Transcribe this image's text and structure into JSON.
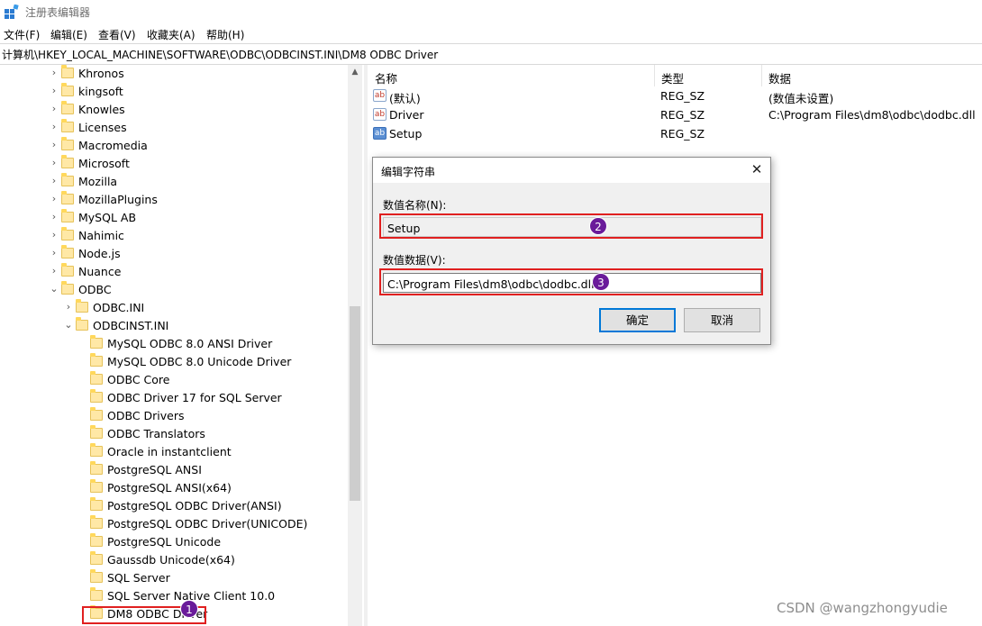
{
  "window": {
    "title": "注册表编辑器"
  },
  "menu": [
    "文件(F)",
    "编辑(E)",
    "查看(V)",
    "收藏夹(A)",
    "帮助(H)"
  ],
  "address": "计算机\\HKEY_LOCAL_MACHINE\\SOFTWARE\\ODBC\\ODBCINST.INI\\DM8 ODBC Driver",
  "tree": {
    "items": [
      {
        "label": "Khronos",
        "level": 0,
        "expander": "collapsed"
      },
      {
        "label": "kingsoft",
        "level": 0,
        "expander": "collapsed"
      },
      {
        "label": "Knowles",
        "level": 0,
        "expander": "collapsed"
      },
      {
        "label": "Licenses",
        "level": 0,
        "expander": "collapsed"
      },
      {
        "label": "Macromedia",
        "level": 0,
        "expander": "collapsed"
      },
      {
        "label": "Microsoft",
        "level": 0,
        "expander": "collapsed"
      },
      {
        "label": "Mozilla",
        "level": 0,
        "expander": "collapsed"
      },
      {
        "label": "MozillaPlugins",
        "level": 0,
        "expander": "collapsed"
      },
      {
        "label": "MySQL AB",
        "level": 0,
        "expander": "collapsed"
      },
      {
        "label": "Nahimic",
        "level": 0,
        "expander": "collapsed"
      },
      {
        "label": "Node.js",
        "level": 0,
        "expander": "collapsed"
      },
      {
        "label": "Nuance",
        "level": 0,
        "expander": "collapsed"
      },
      {
        "label": "ODBC",
        "level": 0,
        "expander": "expanded"
      },
      {
        "label": "ODBC.INI",
        "level": 1,
        "expander": "collapsed"
      },
      {
        "label": "ODBCINST.INI",
        "level": 1,
        "expander": "expanded"
      },
      {
        "label": "MySQL ODBC 8.0 ANSI Driver",
        "level": 2,
        "expander": "none"
      },
      {
        "label": "MySQL ODBC 8.0 Unicode Driver",
        "level": 2,
        "expander": "none"
      },
      {
        "label": "ODBC Core",
        "level": 2,
        "expander": "none"
      },
      {
        "label": "ODBC Driver 17 for SQL Server",
        "level": 2,
        "expander": "none"
      },
      {
        "label": "ODBC Drivers",
        "level": 2,
        "expander": "none"
      },
      {
        "label": "ODBC Translators",
        "level": 2,
        "expander": "none"
      },
      {
        "label": "Oracle in instantclient",
        "level": 2,
        "expander": "none"
      },
      {
        "label": "PostgreSQL ANSI",
        "level": 2,
        "expander": "none"
      },
      {
        "label": "PostgreSQL ANSI(x64)",
        "level": 2,
        "expander": "none"
      },
      {
        "label": "PostgreSQL ODBC Driver(ANSI)",
        "level": 2,
        "expander": "none"
      },
      {
        "label": "PostgreSQL ODBC Driver(UNICODE)",
        "level": 2,
        "expander": "none"
      },
      {
        "label": "PostgreSQL Unicode",
        "level": 2,
        "expander": "none"
      },
      {
        "label": "Gaussdb Unicode(x64)",
        "level": 2,
        "expander": "none"
      },
      {
        "label": "SQL Server",
        "level": 2,
        "expander": "none"
      },
      {
        "label": "SQL Server Native Client 10.0",
        "level": 2,
        "expander": "none"
      },
      {
        "label": "DM8 ODBC Driver",
        "level": 2,
        "expander": "none",
        "selected": true
      }
    ]
  },
  "list": {
    "columns": [
      "名称",
      "类型",
      "数据"
    ],
    "rows": [
      {
        "icon": "string-value-icon",
        "name": "(默认)",
        "type": "REG_SZ",
        "data": "(数值未设置)"
      },
      {
        "icon": "string-value-icon",
        "name": "Driver",
        "type": "REG_SZ",
        "data": "C:\\Program Files\\dm8\\odbc\\dodbc.dll"
      },
      {
        "icon": "string-value-icon",
        "name": "Setup",
        "type": "REG_SZ",
        "data": "",
        "selected": true
      }
    ]
  },
  "dialog": {
    "title": "编辑字符串",
    "close_glyph": "✕",
    "name_label": "数值名称(N):",
    "name_value": "Setup",
    "data_label": "数值数据(V):",
    "data_value": "C:\\Program Files\\dm8\\odbc\\dodbc.dll",
    "ok_label": "确定",
    "cancel_label": "取消"
  },
  "annotations": {
    "badge_1": "1",
    "badge_2": "2",
    "badge_3": "3",
    "highlight_color": "#e02020",
    "badge_color": "#6a1b9a"
  },
  "watermark": "CSDN @wangzhongyudie"
}
